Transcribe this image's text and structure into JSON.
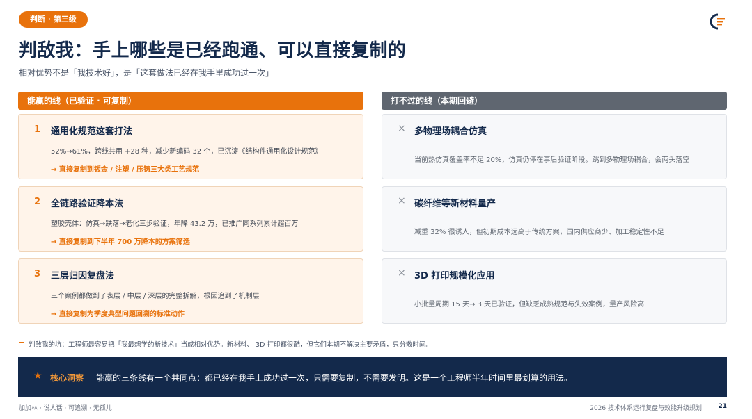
{
  "header": {
    "tag": "判断 · 第三级",
    "title": "判敌我：手上哪些是已经跑通、可以直接复制的",
    "subtitle": "相对优势不是「我技术好」，是「这套做法已经在我手里成功过一次」"
  },
  "win_column": {
    "heading": "能赢的线（已验证 · 可复制）",
    "items": [
      {
        "num": "1",
        "title": "通用化规范这套打法",
        "desc": "52%→61%，跨线共用 +28 种，减少新编码 32 个，已沉淀《结构件通用化设计规范》",
        "link": "→  直接复制到钣金 / 注塑 / 压铸三大类工艺规范"
      },
      {
        "num": "2",
        "title": "全链路验证降本法",
        "desc": "塑胶壳体：仿真→跌落→老化三步验证，年降 43.2 万，已推广同系列累计超百万",
        "link": "→  直接复制到下半年 700 万降本的方案筛选"
      },
      {
        "num": "3",
        "title": "三层归因复盘法",
        "desc": "三个案例都做到了表层 / 中层 / 深层的完整拆解，根因追到了机制层",
        "link": "→  直接复制为季度典型问题回溯的标准动作"
      }
    ]
  },
  "lose_column": {
    "heading": "打不过的线（本期回避）",
    "items": [
      {
        "mark": "×",
        "title": "多物理场耦合仿真",
        "desc": "当前热仿真覆盖率不足 20%，仿真仍停在事后验证阶段。跳到多物理场耦合，会两头落空"
      },
      {
        "mark": "×",
        "title": "碳纤维等新材料量产",
        "desc": "减重 32% 很诱人，但初期成本远高于传统方案，国内供应商少、加工稳定性不足"
      },
      {
        "mark": "×",
        "title": "3D 打印规模化应用",
        "desc": "小批量周期 15 天→ 3 天已验证，但缺乏成熟规范与失效案例，量产风险高"
      }
    ]
  },
  "note": "判敌我的坑：工程师最容易把「我最想学的新技术」当成相对优势。新材料、 3D 打印都很酷，但它们本期不解决主要矛盾，只分散时间。",
  "insight": {
    "star": "★",
    "label": "核心洞察",
    "text": "能赢的三条线有一个共同点：都已经在我手上成功过一次，只需要复制，不需要发明。这是一个工程师半年时间里最划算的用法。"
  },
  "footer": {
    "left": "加加林 · 说人话 · 可追溯 · 无孤儿",
    "right": "2026 技术体系运行复盘与效能升级规划",
    "page": "21"
  },
  "colors": {
    "accent": "#e8720c",
    "navy": "#13294b",
    "gray_header": "#5f6670"
  }
}
